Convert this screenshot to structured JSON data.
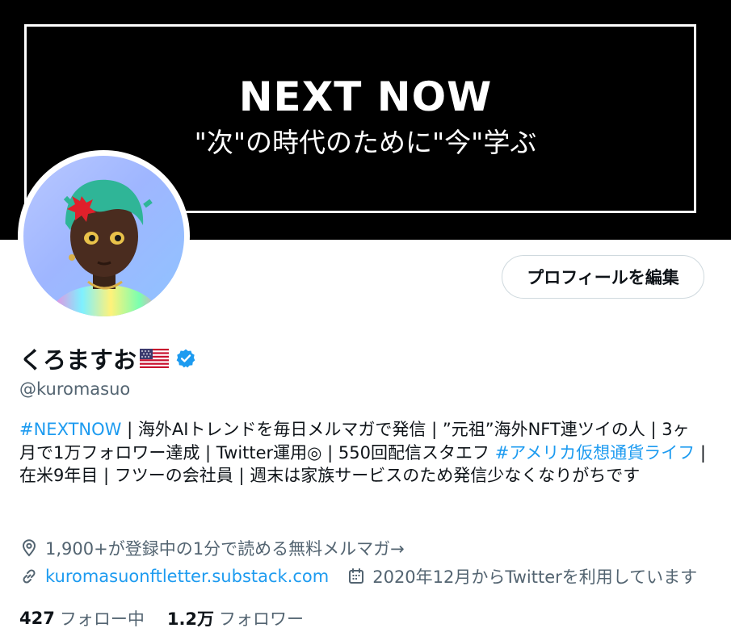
{
  "banner": {
    "title": "NEXT NOW",
    "subtitle": "\"次\"の時代のために\"今\"学ぶ"
  },
  "profile": {
    "edit_label": "プロフィールを編集",
    "display_name": "くろますお",
    "handle": "@kuromasuo",
    "bio": {
      "tag1": "#NEXTNOW",
      "text1": " | 海外AIトレンドを毎日メルマガで発信 | ”元祖”海外NFT連ツイの人 | 3ヶ月で1万フォロワー達成 | Twitter運用◎ | 550回配信スタエフ ",
      "tag2": "#アメリカ仮想通貨ライフ",
      "text2": " | 在米9年目 | フツーの会社員 | 週末は家族サービスのため発信少なくなりがちです"
    },
    "location": "1,900+が登録中の1分で読める無料メルマガ→",
    "url": "kuromasuonftletter.substack.com",
    "joined": "2020年12月からTwitterを利用しています",
    "following_count": "427",
    "following_label": "フォロー中",
    "followers_count": "1.2万",
    "followers_label": "フォロワー"
  },
  "colors": {
    "accent": "#1d9bf0",
    "text": "#0f1419",
    "muted": "#536471",
    "banner": "#000000"
  },
  "icons": [
    "location-icon",
    "link-icon",
    "calendar-icon",
    "verified-badge-icon",
    "us-flag-icon"
  ]
}
